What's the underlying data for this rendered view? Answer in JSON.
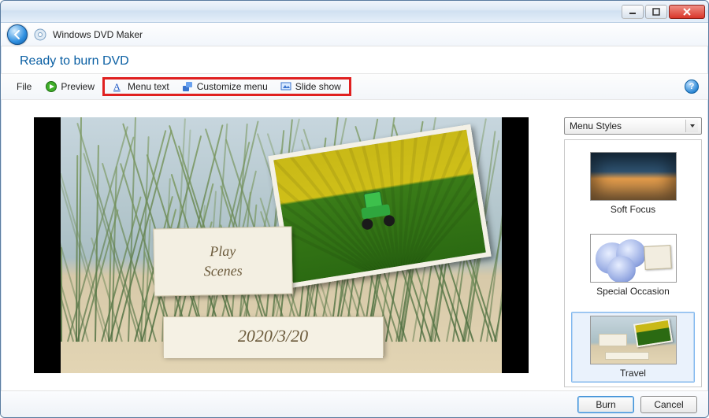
{
  "window": {
    "app_title": "Windows DVD Maker"
  },
  "headline": "Ready to burn DVD",
  "toolbar": {
    "file": "File",
    "preview": "Preview",
    "menu_text": "Menu text",
    "customize_menu": "Customize menu",
    "slide_show": "Slide show"
  },
  "preview_menu": {
    "items": [
      "Play",
      "Scenes"
    ],
    "date": "2020/3/20"
  },
  "sidebar": {
    "combo_label": "Menu Styles",
    "styles": [
      {
        "id": "soft-focus",
        "label": "Soft Focus",
        "selected": false
      },
      {
        "id": "special-occasion",
        "label": "Special Occasion",
        "selected": false
      },
      {
        "id": "travel",
        "label": "Travel",
        "selected": true
      }
    ]
  },
  "footer": {
    "burn": "Burn",
    "cancel": "Cancel"
  },
  "help_glyph": "?"
}
